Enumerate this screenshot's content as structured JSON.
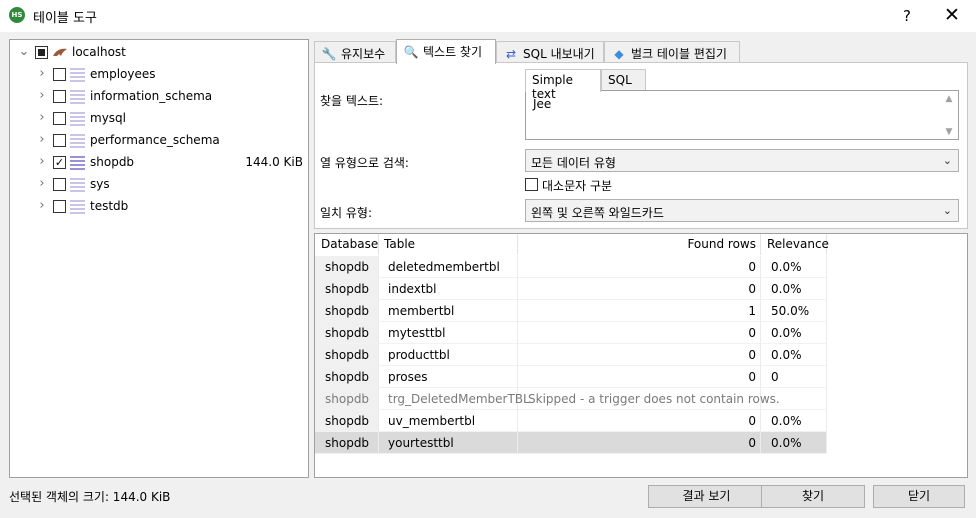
{
  "window": {
    "title": "테이블 도구",
    "app_icon_text": "HS",
    "help_label": "?",
    "close_label": "✕"
  },
  "tree": {
    "root": {
      "label": "localhost",
      "state": "partial",
      "expanded": true
    },
    "items": [
      {
        "label": "employees",
        "checked": false,
        "size": ""
      },
      {
        "label": "information_schema",
        "checked": false,
        "size": ""
      },
      {
        "label": "mysql",
        "checked": false,
        "size": ""
      },
      {
        "label": "performance_schema",
        "checked": false,
        "size": ""
      },
      {
        "label": "shopdb",
        "checked": true,
        "size": "144.0 KiB"
      },
      {
        "label": "sys",
        "checked": false,
        "size": ""
      },
      {
        "label": "testdb",
        "checked": false,
        "size": ""
      }
    ]
  },
  "tabs": [
    {
      "label": "유지보수",
      "icon": "wrench-icon",
      "active": false
    },
    {
      "label": "텍스트 찾기",
      "icon": "magnifier-icon",
      "active": true
    },
    {
      "label": "SQL 내보내기",
      "icon": "export-arrows-icon",
      "active": false
    },
    {
      "label": "벌크 테이블 편집기",
      "icon": "layers-icon",
      "active": false
    }
  ],
  "find": {
    "find_text_label": "찾을 텍스트:",
    "subtabs": [
      "Simple text",
      "SQL"
    ],
    "find_text_value": "Jee",
    "column_type_label": "열 유형으로 검색:",
    "column_type_value": "모든 데이터 유형",
    "case_sensitive_label": "대소문자 구분",
    "case_sensitive_checked": false,
    "match_type_label": "일치 유형:",
    "match_type_value": "왼쪽 및 오른쪽 와일드카드"
  },
  "results": {
    "headers": [
      "Database",
      "Table",
      "Found rows",
      "Relevance"
    ],
    "rows": [
      {
        "db": "shopdb",
        "table": "deletedmembertbl",
        "found": "0",
        "rel": "0.0%"
      },
      {
        "db": "shopdb",
        "table": "indextbl",
        "found": "0",
        "rel": "0.0%"
      },
      {
        "db": "shopdb",
        "table": "membertbl",
        "found": "1",
        "rel": "50.0%"
      },
      {
        "db": "shopdb",
        "table": "mytesttbl",
        "found": "0",
        "rel": "0.0%"
      },
      {
        "db": "shopdb",
        "table": "producttbl",
        "found": "0",
        "rel": "0.0%"
      },
      {
        "db": "shopdb",
        "table": "proses",
        "found": "0",
        "rel": "0"
      },
      {
        "db": "shopdb",
        "table": "trg_DeletedMemberTBL",
        "found": "Skipped - a trigger does not contain rows.",
        "rel": ""
      },
      {
        "db": "shopdb",
        "table": "uv_membertbl",
        "found": "0",
        "rel": "0.0%"
      },
      {
        "db": "shopdb",
        "table": "yourtesttbl",
        "found": "0",
        "rel": "0.0%"
      }
    ]
  },
  "footer": {
    "status": "선택된 객체의 크기: 144.0 KiB",
    "view_results": "결과 보기",
    "find": "찾기",
    "close": "닫기"
  }
}
